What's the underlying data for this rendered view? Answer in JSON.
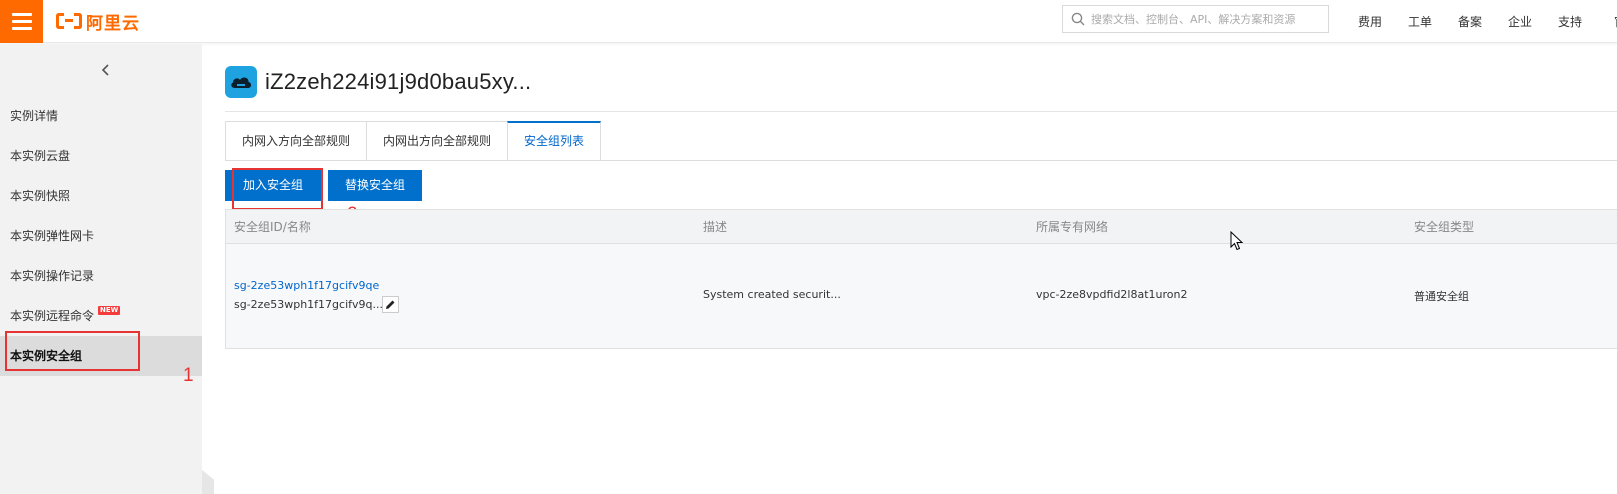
{
  "header": {
    "logo_text": "阿里云",
    "search_placeholder": "搜索文档、控制台、API、解决方案和资源",
    "nav": [
      "费用",
      "工单",
      "备案",
      "企业",
      "支持",
      "官"
    ]
  },
  "sidebar": {
    "items": [
      {
        "label": "实例详情"
      },
      {
        "label": "本实例云盘"
      },
      {
        "label": "本实例快照"
      },
      {
        "label": "本实例弹性网卡"
      },
      {
        "label": "本实例操作记录"
      },
      {
        "label": "本实例远程命令",
        "badge": "NEW"
      },
      {
        "label": "本实例安全组",
        "active": true
      }
    ]
  },
  "page": {
    "title": "iZ2zeh224i91j9d0bau5xy..."
  },
  "tabs": [
    {
      "label": "内网入方向全部规则"
    },
    {
      "label": "内网出方向全部规则"
    },
    {
      "label": "安全组列表",
      "active": true
    }
  ],
  "toolbar": {
    "join_label": "加入安全组",
    "replace_label": "替换安全组"
  },
  "table": {
    "columns": [
      "安全组ID/名称",
      "描述",
      "所属专有网络",
      "安全组类型"
    ],
    "rows": [
      {
        "id": "sg-2ze53wph1f17gcifv9qe",
        "name": "sg-2ze53wph1f17gcifv9q...",
        "description": "System created securit...",
        "vpc": "vpc-2ze8vpdfid2l8at1uron2",
        "type": "普通安全组"
      }
    ]
  },
  "annotations": [
    "1",
    "2"
  ],
  "colors": {
    "brand": "#ff6a00",
    "primary": "#0070cc",
    "annotation": "#e63434"
  }
}
